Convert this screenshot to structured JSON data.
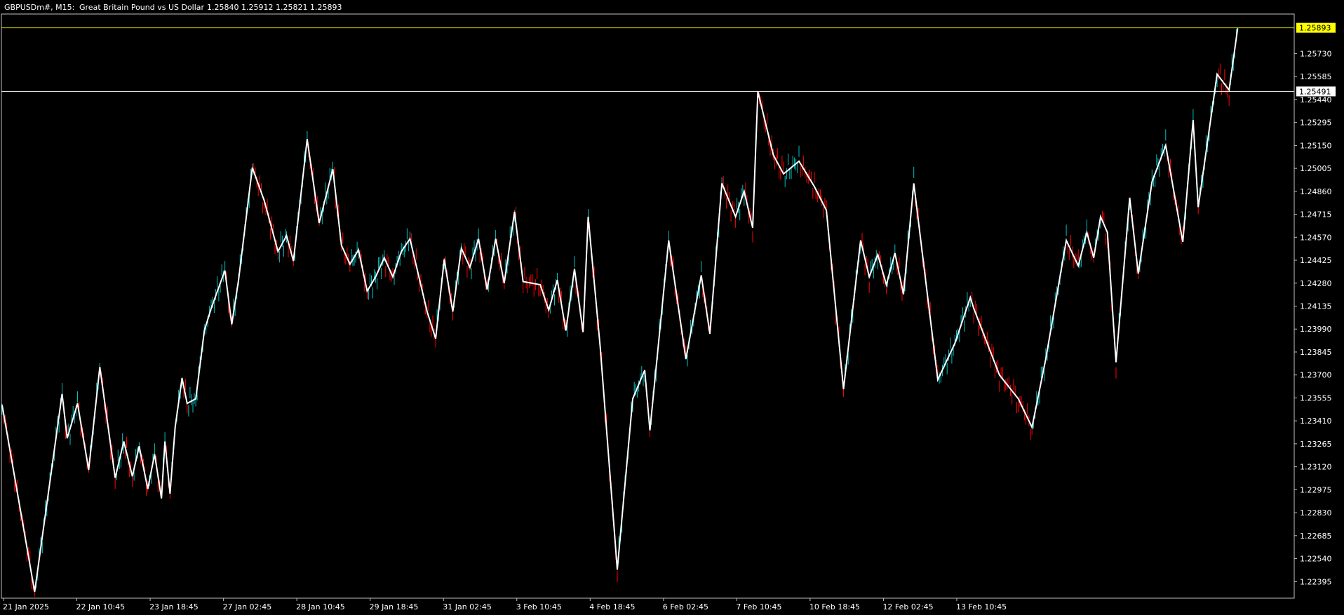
{
  "header": {
    "symbol": "GBPUSDm#, M15:",
    "description": "Great Britain Pound vs US Dollar",
    "ohlc": "1.25840 1.25912 1.25821 1.25893"
  },
  "colors": {
    "background": "#000000",
    "frame": "#c0c0c0",
    "text": "#ffffff",
    "bull_candle": "#00c0c0",
    "bear_candle": "#ff0000",
    "zigzag": "#ffffff",
    "current_price_line": "#c8c800",
    "current_price_tag_bg": "#ffff00",
    "level_line": "#ffffff"
  },
  "current_price": {
    "value": 1.25893,
    "label": "1.25893"
  },
  "level_line": {
    "value": 1.25491,
    "label": "1.25491"
  },
  "chart_data": {
    "type": "line",
    "title": "",
    "xlabel": "",
    "ylabel": "",
    "ylim": [
      1.2229,
      1.2598
    ],
    "grid": false,
    "y_ticks": [
      1.2573,
      1.25585,
      1.2544,
      1.25295,
      1.2515,
      1.25005,
      1.2486,
      1.24715,
      1.2457,
      1.24425,
      1.2428,
      1.24135,
      1.2399,
      1.23845,
      1.237,
      1.23555,
      1.2341,
      1.23265,
      1.2312,
      1.22975,
      1.2283,
      1.22685,
      1.2254,
      1.22395
    ],
    "y_tick_labels": [
      "1.25730",
      "1.25585",
      "1.25440",
      "1.25295",
      "1.25150",
      "1.25005",
      "1.24860",
      "1.24715",
      "1.24570",
      "1.24425",
      "1.24280",
      "1.24135",
      "1.23990",
      "1.23845",
      "1.23700",
      "1.23555",
      "1.23410",
      "1.23265",
      "1.23120",
      "1.22975",
      "1.22830",
      "1.22685",
      "1.22540",
      "1.22395"
    ],
    "x_tick_labels": [
      "21 Jan 2025",
      "22 Jan 10:45",
      "23 Jan 18:45",
      "27 Jan 02:45",
      "28 Jan 10:45",
      "29 Jan 18:45",
      "31 Jan 02:45",
      "3 Feb 10:45",
      "4 Feb 18:45",
      "6 Feb 02:45",
      "7 Feb 10:45",
      "10 Feb 18:45",
      "12 Feb 02:45",
      "13 Feb 10:45"
    ],
    "x_range": [
      0,
      1410
    ],
    "zigzag": {
      "x": [
        0,
        38,
        70,
        76,
        88,
        101,
        114,
        132,
        142,
        152,
        160,
        170,
        178,
        186,
        190,
        196,
        202,
        210,
        216,
        226,
        236,
        244,
        260,
        268,
        276,
        292,
        306,
        322,
        332,
        340,
        356,
        370,
        386,
        396,
        406,
        416,
        426,
        436,
        446,
        456,
        466,
        476,
        496,
        506,
        516,
        526,
        536,
        546,
        556,
        566,
        576,
        586,
        598,
        608,
        628,
        638,
        648,
        658,
        668,
        678,
        684,
        698,
        718,
        736,
        750,
        756,
        778,
        798,
        816,
        826,
        840,
        856,
        866,
        876,
        882,
        900,
        912,
        930,
        948,
        962,
        982,
        1002,
        1012,
        1022,
        1032,
        1042,
        1052,
        1064,
        1092,
        1112,
        1130,
        1134,
        1164,
        1186,
        1202,
        1218,
        1242,
        1256,
        1266,
        1274,
        1282,
        1290,
        1300,
        1316,
        1326,
        1342,
        1358,
        1378,
        1390,
        1396,
        1418,
        1432,
        1442
      ],
      "y": [
        1.2351,
        1.2233,
        1.2358,
        1.233,
        1.2352,
        1.231,
        1.2375,
        1.2305,
        1.2328,
        1.2306,
        1.2325,
        1.2298,
        1.232,
        1.2292,
        1.2328,
        1.2295,
        1.2337,
        1.2368,
        1.2352,
        1.2355,
        1.2398,
        1.2412,
        1.2436,
        1.2402,
        1.243,
        1.2501,
        1.248,
        1.2448,
        1.2458,
        1.2442,
        1.2519,
        1.2466,
        1.25,
        1.2452,
        1.244,
        1.2449,
        1.2423,
        1.2432,
        1.2444,
        1.2432,
        1.2448,
        1.2456,
        1.241,
        1.2393,
        1.2443,
        1.241,
        1.245,
        1.2438,
        1.2456,
        1.2424,
        1.2456,
        1.2428,
        1.2473,
        1.2429,
        1.2427,
        1.2411,
        1.243,
        1.2398,
        1.2437,
        1.2397,
        1.247,
        1.2388,
        1.2247,
        1.2355,
        1.2373,
        1.2335,
        1.2455,
        1.238,
        1.2433,
        1.2396,
        1.2491,
        1.247,
        1.2486,
        1.2463,
        1.2549,
        1.2509,
        1.2497,
        1.2505,
        1.2489,
        1.2474,
        1.2361,
        1.2455,
        1.2432,
        1.2446,
        1.2427,
        1.2447,
        1.2421,
        1.2491,
        1.2367,
        1.239,
        1.2419,
        1.2412,
        1.237,
        1.2355,
        1.2337,
        1.238,
        1.2455,
        1.2439,
        1.246,
        1.2444,
        1.247,
        1.246,
        1.2378,
        1.2482,
        1.2434,
        1.2492,
        1.2515,
        1.2454,
        1.2531,
        1.2476,
        1.256,
        1.255,
        1.2589
      ]
    }
  }
}
